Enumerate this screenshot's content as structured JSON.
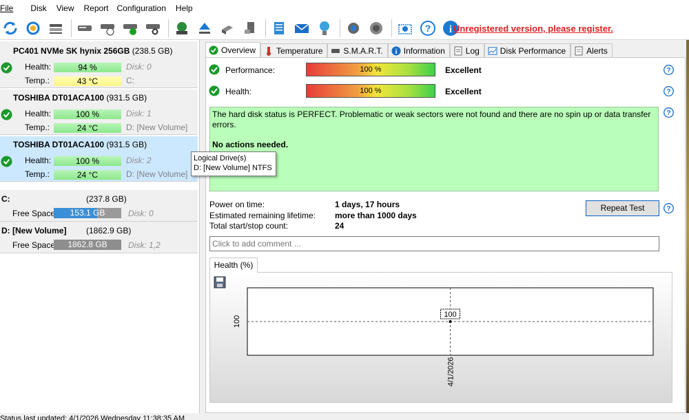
{
  "menu": [
    "File",
    "Disk",
    "View",
    "Report",
    "Configuration",
    "Help"
  ],
  "register_text": "Unregistered version, please register.",
  "disks": [
    {
      "name": "PC401 NVMe SK hynix 256GB",
      "size": "(238.5 GB)",
      "health_label": "Health:",
      "health": "94 %",
      "health_value": 0.94,
      "health_side": "Disk: 0",
      "temp_label": "Temp.:",
      "temp": "43 °C",
      "temp_side": "C:"
    },
    {
      "name": "TOSHIBA DT01ACA100",
      "size": "(931.5 GB)",
      "health_label": "Health:",
      "health": "100 %",
      "health_value": 1.0,
      "health_side": "Disk: 1",
      "temp_label": "Temp.:",
      "temp": "24 °C",
      "temp_side": "D: [New Volume]"
    },
    {
      "name": "TOSHIBA DT01ACA100",
      "size": "(931.5 GB)",
      "health_label": "Health:",
      "health": "100 %",
      "health_value": 1.0,
      "health_side": "Disk: 2",
      "temp_label": "Temp.:",
      "temp": "24 °C",
      "temp_side": "D: [New Volume]"
    }
  ],
  "volumes": [
    {
      "name": "C:",
      "size": "(237.8 GB)",
      "free_label": "Free Space",
      "free": "153.1 GB",
      "free_fraction": 0.64,
      "disk": "Disk: 0"
    },
    {
      "name": "D: [New Volume]",
      "size": "(1862.9 GB)",
      "free_label": "Free Space",
      "free": "1862.8 GB",
      "free_fraction": 1.0,
      "disk": "Disk: 1,2"
    }
  ],
  "tooltip": {
    "line1": "Logical Drive(s)",
    "line2": "D: [New Volume] NTFS"
  },
  "tabs": [
    "Overview",
    "Temperature",
    "S.M.A.R.T.",
    "Information",
    "Log",
    "Disk Performance",
    "Alerts"
  ],
  "overview": {
    "performance_label": "Performance:",
    "performance_value": "100 %",
    "performance_rating": "Excellent",
    "health_label": "Health:",
    "health_value": "100 %",
    "health_rating": "Excellent",
    "status_text": "The hard disk status is PERFECT. Problematic or weak sectors were not found and there are no spin up or data transfer errors.",
    "action_text": "No actions needed.",
    "power_on_label": "Power on time:",
    "power_on_value": "1 days, 17 hours",
    "lifetime_label": "Estimated remaining lifetime:",
    "lifetime_value": "more than 1000 days",
    "startstop_label": "Total start/stop count:",
    "startstop_value": "24",
    "repeat_button": "Repeat Test",
    "comment_placeholder": "Click to add comment ..."
  },
  "chart_tab": "Health (%)",
  "chart_data": {
    "type": "line",
    "x": [
      "4/1/2026"
    ],
    "y": [
      100
    ],
    "ylabel_tick": "100",
    "point_label": "100",
    "title": "",
    "xlabel": "",
    "ylabel": ""
  },
  "statusbar": "Status last updated: 4/1/2026 Wednesday 11:38:35 AM",
  "colors": {
    "register": "#e02020",
    "status_box": "#b9ffb9",
    "selected_disk": "#cce8ff",
    "free_space_fill": "#3b8fd6"
  }
}
